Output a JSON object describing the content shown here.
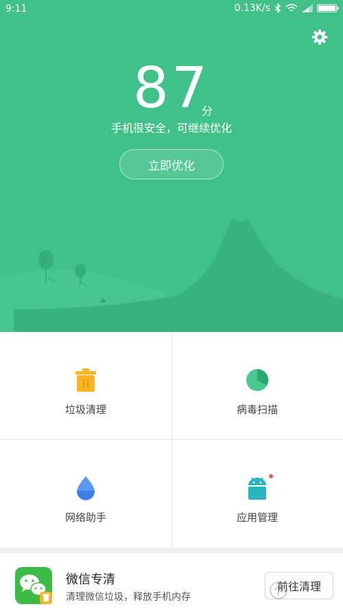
{
  "status_bar": {
    "time": "9:11",
    "net_speed": "0.13K/s",
    "icons": [
      "bluetooth-icon",
      "wifi-icon",
      "signal-icon",
      "battery-icon"
    ]
  },
  "header": {
    "settings_icon": "gear-icon"
  },
  "score": {
    "value": "87",
    "unit": "分",
    "description": "手机很安全，可继续优化"
  },
  "optimize_button": {
    "label": "立即优化"
  },
  "tools": [
    {
      "label": "垃圾清理",
      "icon": "trash-can-icon",
      "color": "#fbb522"
    },
    {
      "label": "病毒扫描",
      "icon": "virus-scan-icon",
      "color": "#3fc189"
    },
    {
      "label": "网络助手",
      "icon": "water-drop-icon",
      "color": "#4e8ff0"
    },
    {
      "label": "应用管理",
      "icon": "android-robot-icon",
      "color": "#2ab4c0",
      "badge": true
    }
  ],
  "card": {
    "title": "微信专清",
    "description": "清理微信垃圾，释放手机内存",
    "button_label": "前往清理",
    "icon": "wechat-icon"
  },
  "colors": {
    "hero": "#3fc189",
    "hills_light": "#46c592",
    "hills_dark": "#35ad7c"
  }
}
